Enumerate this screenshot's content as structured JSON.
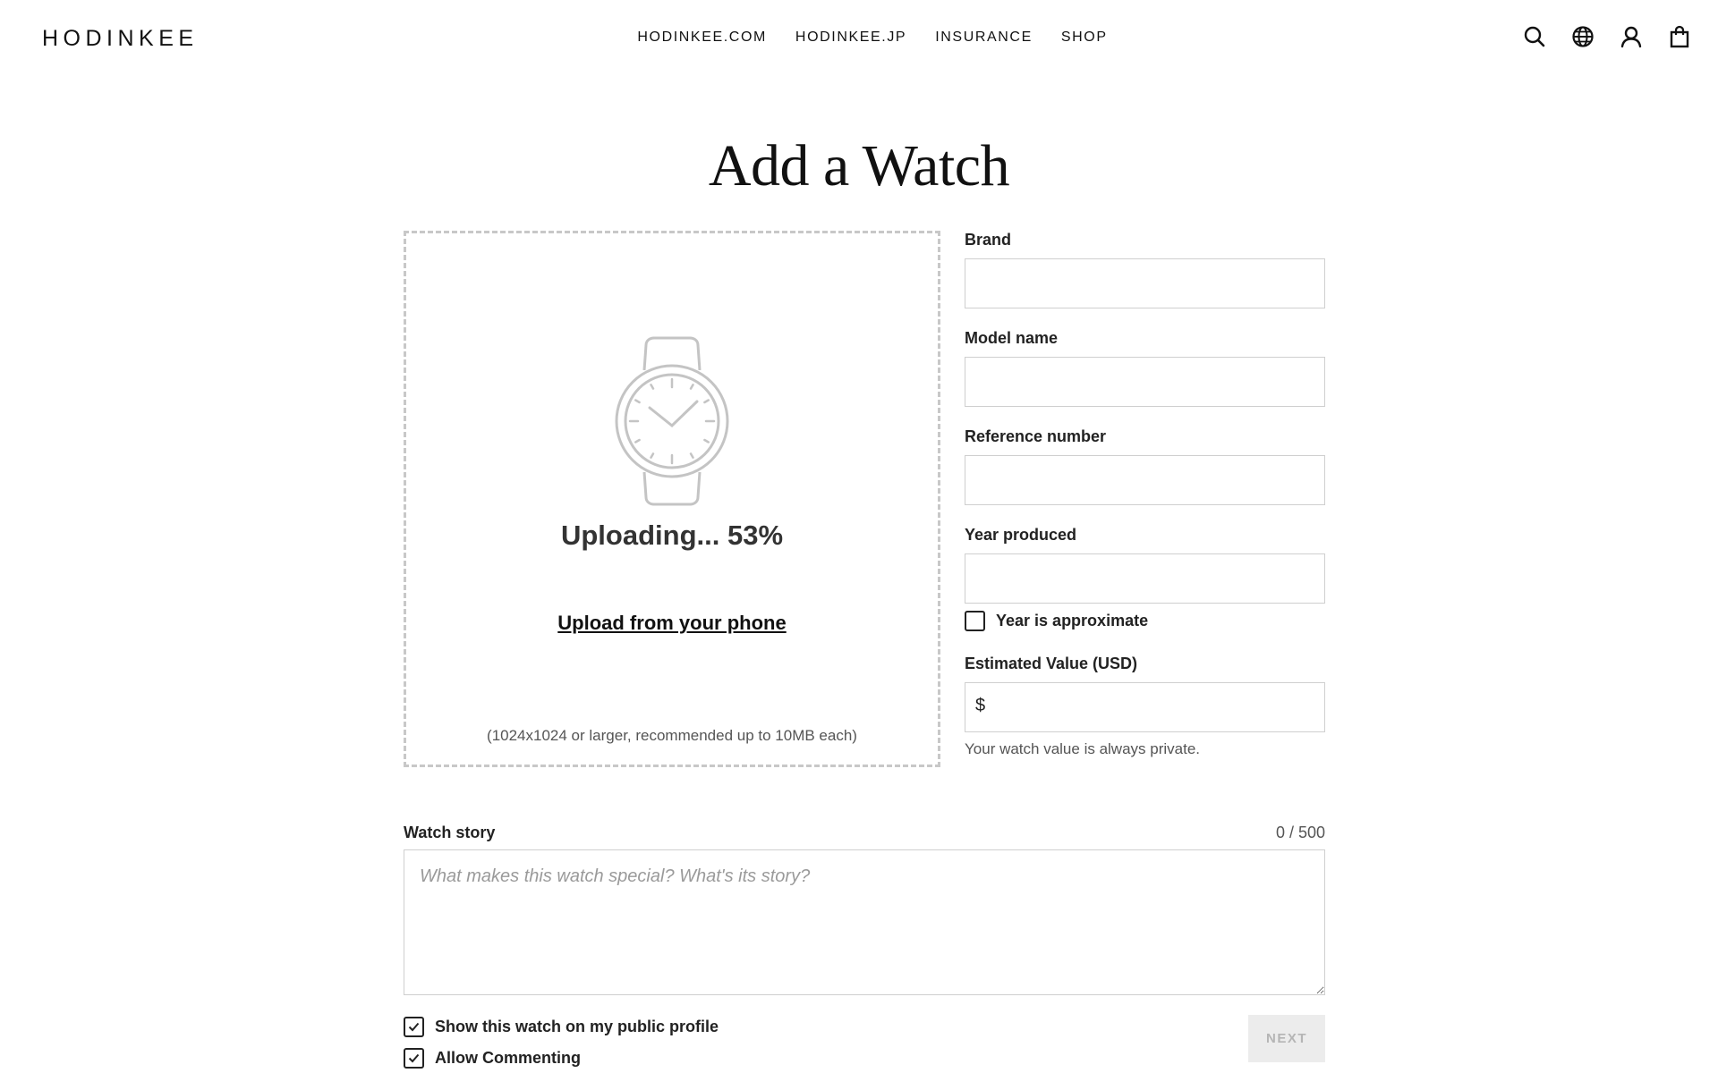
{
  "header": {
    "logo": "HODINKEE",
    "nav": [
      "HODINKEE.COM",
      "HODINKEE.JP",
      "INSURANCE",
      "SHOP"
    ],
    "icons": [
      "search-icon",
      "globe-icon",
      "user-icon",
      "shopping-bag-icon"
    ]
  },
  "page": {
    "title": "Add a Watch"
  },
  "upload": {
    "status": "Uploading... 53%",
    "progress_percent": 53,
    "phone_link": "Upload from your phone",
    "hint": "(1024x1024 or larger, recommended up to 10MB each)"
  },
  "form": {
    "brand_label": "Brand",
    "brand_value": "",
    "model_label": "Model name",
    "model_value": "",
    "reference_label": "Reference number",
    "reference_value": "",
    "year_label": "Year produced",
    "year_value": "",
    "year_approx_label": "Year is approximate",
    "year_approx_checked": false,
    "value_label": "Estimated Value (USD)",
    "value_prefix": "$",
    "value_value": "",
    "value_note": "Your watch value is always private."
  },
  "story": {
    "label": "Watch story",
    "counter": "0 / 500",
    "placeholder": "What makes this watch special? What's its story?",
    "value": ""
  },
  "options": {
    "public_profile_label": "Show this watch on my public profile",
    "public_profile_checked": true,
    "allow_comments_label": "Allow Commenting",
    "allow_comments_checked": true
  },
  "actions": {
    "next_label": "NEXT"
  },
  "colors": {
    "border": "#cfcfcf",
    "dashed_border": "#c8c8c8",
    "disabled_button_bg": "#ececec",
    "disabled_button_text": "#b5b5b5"
  }
}
